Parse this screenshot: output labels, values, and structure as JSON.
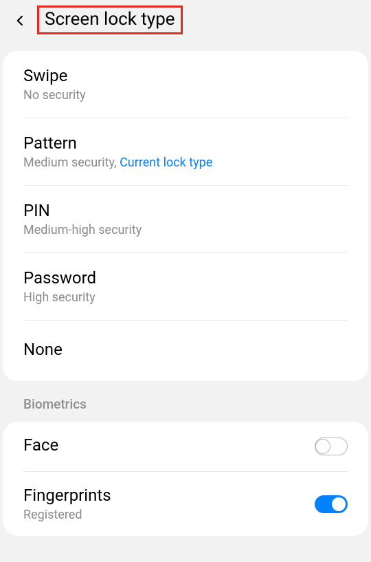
{
  "header": {
    "title": "Screen lock type"
  },
  "lockTypes": [
    {
      "title": "Swipe",
      "subtitle": "No security",
      "link": ""
    },
    {
      "title": "Pattern",
      "subtitle": "Medium security, ",
      "link": "Current lock type"
    },
    {
      "title": "PIN",
      "subtitle": "Medium-high security",
      "link": ""
    },
    {
      "title": "Password",
      "subtitle": "High security",
      "link": ""
    },
    {
      "title": "None",
      "subtitle": "",
      "link": ""
    }
  ],
  "biometricsHeader": "Biometrics",
  "biometrics": [
    {
      "title": "Face",
      "subtitle": "",
      "enabled": false
    },
    {
      "title": "Fingerprints",
      "subtitle": "Registered",
      "enabled": true
    }
  ],
  "colors": {
    "highlightBox": "#e8281e",
    "accent": "#0381fe"
  }
}
